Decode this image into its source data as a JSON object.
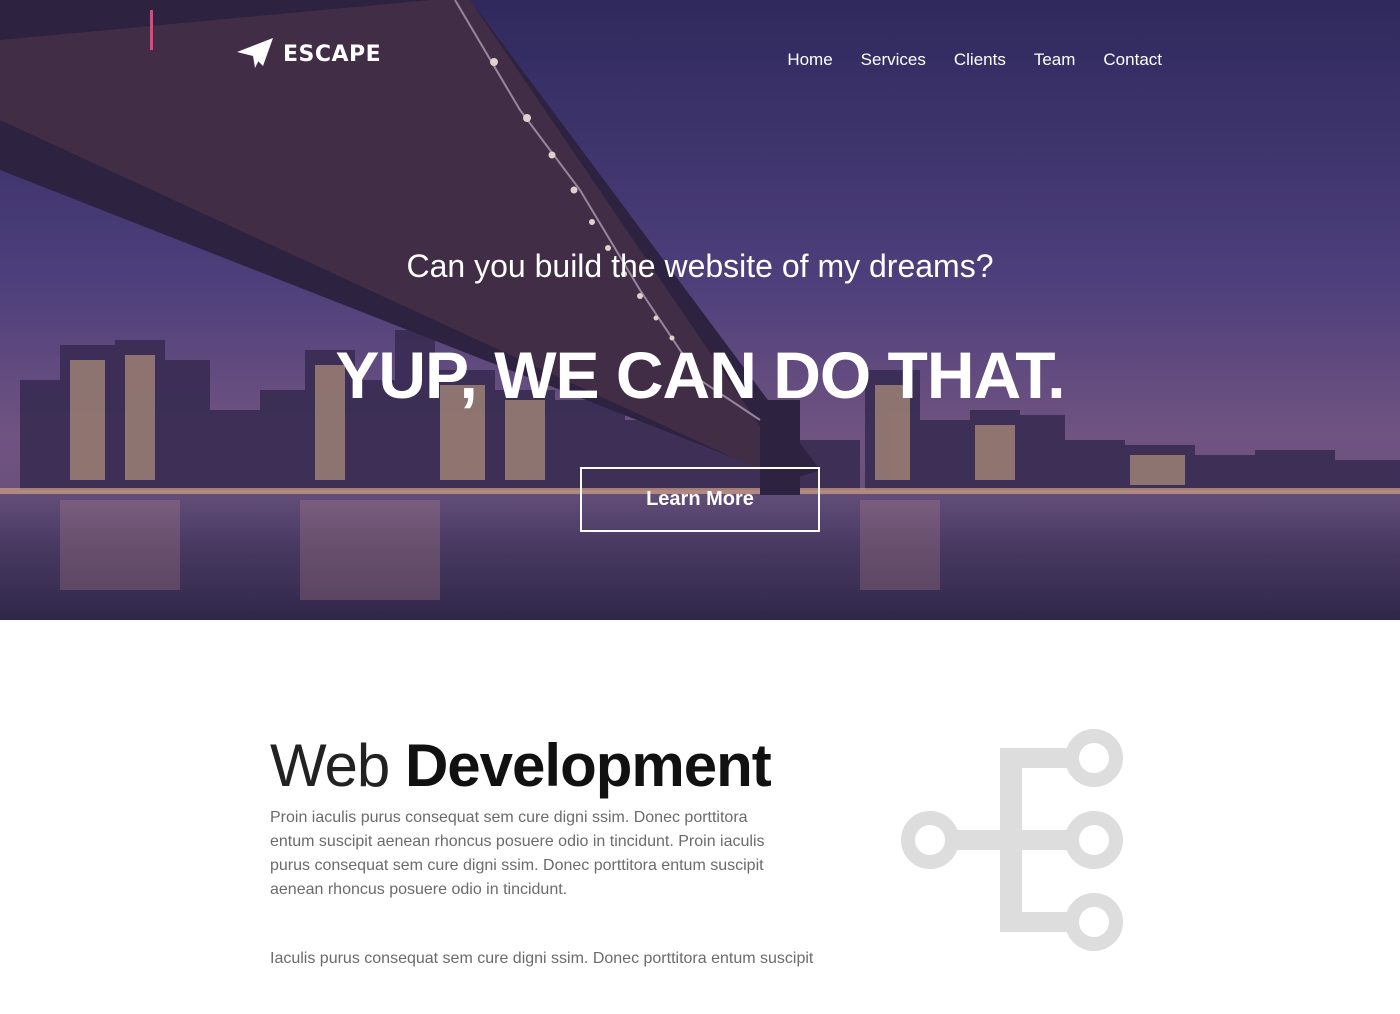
{
  "brand": {
    "name": "ESCAPE",
    "logo_icon": "paper-plane-icon"
  },
  "nav": {
    "items": [
      {
        "label": "Home"
      },
      {
        "label": "Services"
      },
      {
        "label": "Clients"
      },
      {
        "label": "Team"
      },
      {
        "label": "Contact"
      }
    ]
  },
  "hero": {
    "subtitle": "Can you build the website of my dreams?",
    "title": "YUP, WE CAN DO THAT.",
    "button_label": "Learn More"
  },
  "section": {
    "title_light": "Web",
    "title_bold": "Development",
    "paragraph_1": "Proin iaculis purus consequat sem cure digni ssim. Donec porttitora entum suscipit aenean rhoncus posuere odio in tincidunt. Proin iaculis purus consequat sem cure digni ssim. Donec porttitora entum suscipit aenean rhoncus posuere odio in tincidunt.",
    "paragraph_2": "Iaculis purus consequat sem cure digni ssim. Donec porttitora entum suscipit",
    "icon": "sitemap-icon"
  },
  "colors": {
    "hero_top": "#2f2a5a",
    "hero_mid": "#6a4f86",
    "text_dark": "#111111",
    "text_muted": "#6b6b6b",
    "icon_gray": "#dddddd"
  }
}
